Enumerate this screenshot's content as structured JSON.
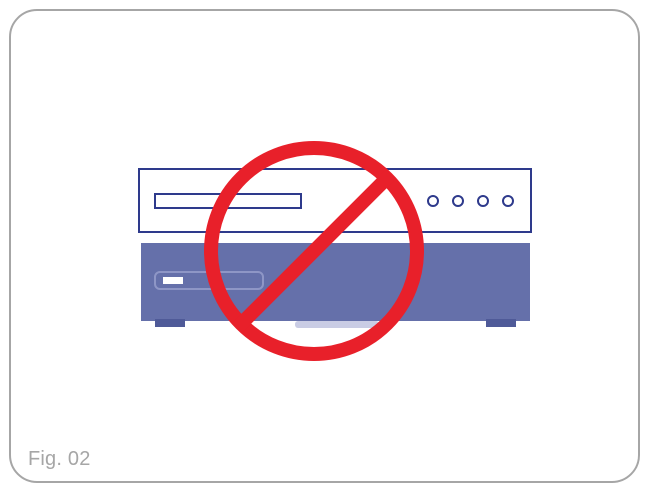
{
  "figure": {
    "caption": "Fig. 02"
  },
  "colors": {
    "border": "#a6a6a6",
    "player_outline": "#2e3a8c",
    "player_fill": "#ffffff",
    "base_device": "#6570aa",
    "base_device_dark": "#4f5a98",
    "prohibition": "#e8202a",
    "caption": "#a6a6a6"
  },
  "icons": {
    "prohibition": "no-stacking-icon"
  }
}
